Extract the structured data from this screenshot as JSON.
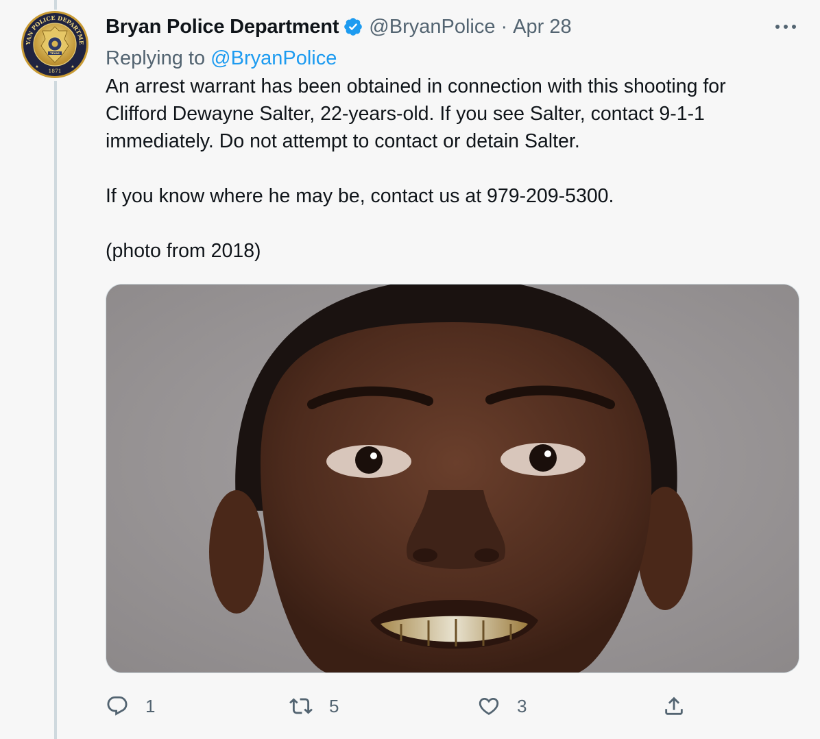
{
  "tweet": {
    "author": {
      "display_name": "Bryan Police Department",
      "handle": "@BryanPolice",
      "verified": true,
      "avatar_text": {
        "top": "BRYAN POLICE DEPARTMENT",
        "year": "1871",
        "state": "TEXAS"
      }
    },
    "separator": "·",
    "date": "Apr 28",
    "replying_prefix": "Replying to",
    "replying_to": "@BryanPolice",
    "text_lines": [
      "An arrest warrant has been obtained in connection with this shooting for",
      "Clifford Dewayne Salter, 22-years-old. If you see Salter, contact 9-1-1",
      "immediately. Do not attempt to contact or detain Salter.",
      "If you know where he may be, contact us at 979-209-5300.",
      "(photo from 2018)"
    ],
    "actions": {
      "replies": "1",
      "retweets": "5",
      "likes": "3"
    }
  },
  "colors": {
    "background": "#f7f7f7",
    "primary_text": "#0f1419",
    "secondary_text": "#536471",
    "link": "#1d9bf0",
    "verified_badge": "#1d9bf0",
    "thread_line": "#cfd9de"
  },
  "icons": {
    "more": "more-horizontal-icon",
    "verified": "verified-badge-icon",
    "reply": "reply-icon",
    "retweet": "retweet-icon",
    "like": "heart-icon",
    "share": "share-icon"
  }
}
